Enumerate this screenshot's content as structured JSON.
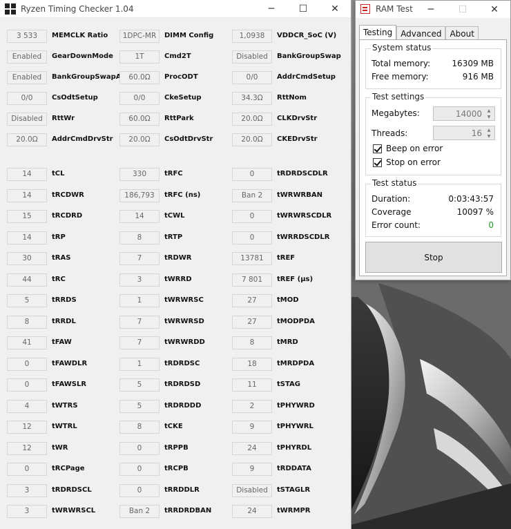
{
  "rtc": {
    "title": "Ryzen Timing Checker 1.04",
    "col1": [
      {
        "value": "3 533",
        "label": "MEMCLK Ratio"
      },
      {
        "value": "Enabled",
        "label": "GearDownMode"
      },
      {
        "value": "Enabled",
        "label": "BankGroupSwapAlt"
      },
      {
        "value": "0/0",
        "label": "CsOdtSetup"
      },
      {
        "value": "Disabled",
        "label": "RttWr"
      },
      {
        "value": "20.0Ω",
        "label": "AddrCmdDrvStr"
      },
      {
        "value": "14",
        "label": "tCL"
      },
      {
        "value": "14",
        "label": "tRCDWR"
      },
      {
        "value": "15",
        "label": "tRCDRD"
      },
      {
        "value": "14",
        "label": "tRP"
      },
      {
        "value": "30",
        "label": "tRAS"
      },
      {
        "value": "44",
        "label": "tRC"
      },
      {
        "value": "5",
        "label": "tRRDS"
      },
      {
        "value": "8",
        "label": "tRRDL"
      },
      {
        "value": "41",
        "label": "tFAW"
      },
      {
        "value": "0",
        "label": "tFAWDLR"
      },
      {
        "value": "0",
        "label": "tFAWSLR"
      },
      {
        "value": "4",
        "label": "tWTRS"
      },
      {
        "value": "12",
        "label": "tWTRL"
      },
      {
        "value": "12",
        "label": "tWR"
      },
      {
        "value": "0",
        "label": "tRCPage"
      },
      {
        "value": "3",
        "label": "tRDRDSCL"
      },
      {
        "value": "3",
        "label": "tWRWRSCL"
      }
    ],
    "col2": [
      {
        "value": "1DPC-MR",
        "label": "DIMM Config"
      },
      {
        "value": "1T",
        "label": "Cmd2T"
      },
      {
        "value": "60.0Ω",
        "label": "ProcODT"
      },
      {
        "value": "0/0",
        "label": "CkeSetup"
      },
      {
        "value": "60.0Ω",
        "label": "RttPark"
      },
      {
        "value": "20.0Ω",
        "label": "CsOdtDrvStr"
      },
      {
        "value": "330",
        "label": "tRFC"
      },
      {
        "value": "186,793",
        "label": "tRFC (ns)"
      },
      {
        "value": "14",
        "label": "tCWL"
      },
      {
        "value": "8",
        "label": "tRTP"
      },
      {
        "value": "7",
        "label": "tRDWR"
      },
      {
        "value": "3",
        "label": "tWRRD"
      },
      {
        "value": "1",
        "label": "tWRWRSC"
      },
      {
        "value": "7",
        "label": "tWRWRSD"
      },
      {
        "value": "7",
        "label": "tWRWRDD"
      },
      {
        "value": "1",
        "label": "tRDRDSC"
      },
      {
        "value": "5",
        "label": "tRDRDSD"
      },
      {
        "value": "5",
        "label": "tRDRDDD"
      },
      {
        "value": "8",
        "label": "tCKE"
      },
      {
        "value": "0",
        "label": "tRPPB"
      },
      {
        "value": "0",
        "label": "tRCPB"
      },
      {
        "value": "0",
        "label": "tRRDDLR"
      },
      {
        "value": "Ban 2",
        "label": "tRRDRDBAN"
      }
    ],
    "col3": [
      {
        "value": "1,0938",
        "label": "VDDCR_SoC (V)"
      },
      {
        "value": "Disabled",
        "label": "BankGroupSwap"
      },
      {
        "value": "0/0",
        "label": "AddrCmdSetup"
      },
      {
        "value": "34.3Ω",
        "label": "RttNom"
      },
      {
        "value": "20.0Ω",
        "label": "CLKDrvStr"
      },
      {
        "value": "20.0Ω",
        "label": "CKEDrvStr"
      },
      {
        "value": "0",
        "label": "tRDRDSCDLR"
      },
      {
        "value": "Ban 2",
        "label": "tWRWRBAN"
      },
      {
        "value": "0",
        "label": "tWRWRSCDLR"
      },
      {
        "value": "0",
        "label": "tWRRDSCDLR"
      },
      {
        "value": "13781",
        "label": "tREF"
      },
      {
        "value": "7 801",
        "label": "tREF (μs)"
      },
      {
        "value": "27",
        "label": "tMOD"
      },
      {
        "value": "27",
        "label": "tMODPDA"
      },
      {
        "value": "8",
        "label": "tMRD"
      },
      {
        "value": "18",
        "label": "tMRDPDA"
      },
      {
        "value": "11",
        "label": "tSTAG"
      },
      {
        "value": "2",
        "label": "tPHYWRD"
      },
      {
        "value": "9",
        "label": "tPHYWRL"
      },
      {
        "value": "24",
        "label": "tPHYRDL"
      },
      {
        "value": "9",
        "label": "tRDDATA"
      },
      {
        "value": "Disabled",
        "label": "tSTAGLR"
      },
      {
        "value": "24",
        "label": "tWRMPR"
      }
    ]
  },
  "ramtest": {
    "title": "RAM Test",
    "tabs": [
      "Testing",
      "Advanced",
      "About"
    ],
    "system_status": {
      "title": "System status",
      "total_label": "Total memory:",
      "total_value": "16309 MB",
      "free_label": "Free memory:",
      "free_value": "916 MB"
    },
    "test_settings": {
      "title": "Test settings",
      "megabytes_label": "Megabytes:",
      "megabytes_value": "14000",
      "threads_label": "Threads:",
      "threads_value": "16",
      "beep_label": "Beep on error",
      "stop_label": "Stop on error"
    },
    "test_status": {
      "title": "Test status",
      "duration_label": "Duration:",
      "duration_value": "0:03:43:57",
      "coverage_label": "Coverage",
      "coverage_value": "10097 %",
      "errors_label": "Error count:",
      "errors_value": "0"
    },
    "stop_button": "Stop"
  },
  "colors": {
    "accent_red": "#cc2222",
    "error_green": "#229922"
  },
  "icons": {
    "minimize": "─",
    "maximize": "☐",
    "close": "✕",
    "spin_up": "▲",
    "spin_down": "▼"
  }
}
